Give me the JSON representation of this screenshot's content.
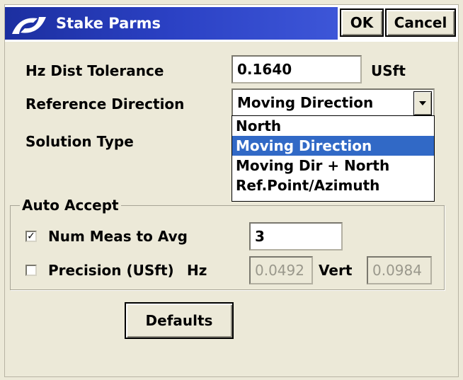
{
  "title_bar": {
    "title": "Stake Parms",
    "ok_label": "OK",
    "cancel_label": "Cancel",
    "logo_icon": "stakeout-logo-icon",
    "accent": "#2b41c4"
  },
  "hz_dist_tolerance": {
    "label": "Hz Dist Tolerance",
    "value": "0.1640",
    "unit": "USft"
  },
  "reference_direction": {
    "label": "Reference Direction",
    "value": "Moving Direction",
    "options": [
      "North",
      "Moving Direction",
      "Moving Dir + North",
      "Ref.Point/Azimuth"
    ],
    "selected_index": 1,
    "arrow_icon": "dropdown-arrow-icon"
  },
  "solution_type": {
    "label": "Solution Type"
  },
  "auto_accept": {
    "group_label": "Auto Accept",
    "num_meas": {
      "label": "Num Meas to Avg",
      "checked": true,
      "check_mark": "✓",
      "value": "3"
    },
    "precision": {
      "label": "Precision (USft)",
      "checked": false,
      "hz_label": "Hz",
      "hz_value": "0.0492",
      "vert_label": "Vert",
      "vert_value": "0.0984"
    }
  },
  "defaults_label": "Defaults",
  "colors": {
    "dialog_bg": "#ece9d8",
    "selection": "#3169c6"
  }
}
